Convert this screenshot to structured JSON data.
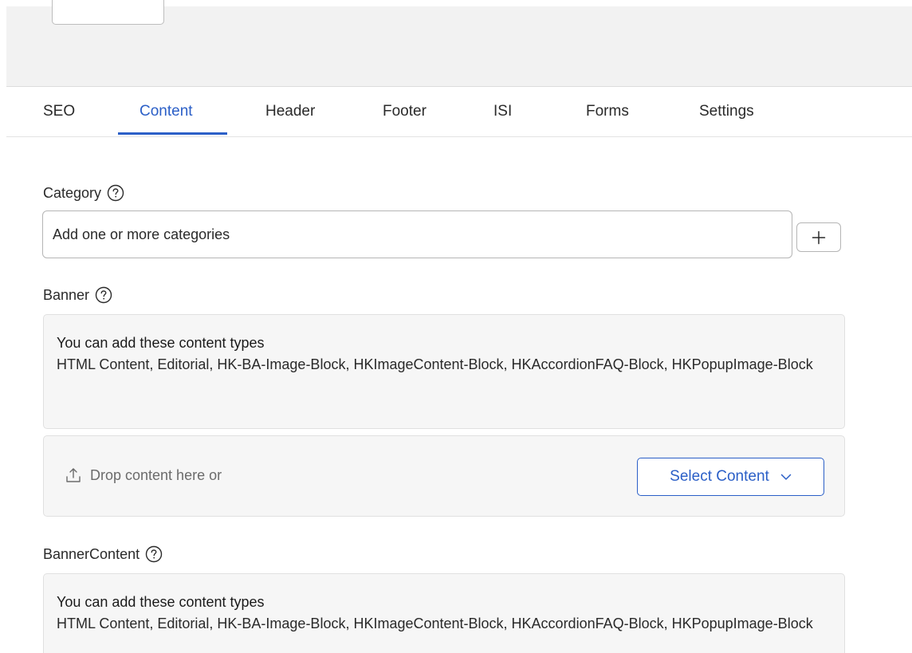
{
  "tabs": [
    {
      "label": "SEO",
      "active": false
    },
    {
      "label": "Content",
      "active": true
    },
    {
      "label": "Header",
      "active": false
    },
    {
      "label": "Footer",
      "active": false
    },
    {
      "label": "ISI",
      "active": false
    },
    {
      "label": "Forms",
      "active": false
    },
    {
      "label": "Settings",
      "active": false
    }
  ],
  "category": {
    "label": "Category",
    "placeholder": "Add one or more categories",
    "add_icon": "plus-icon"
  },
  "banner": {
    "label": "Banner",
    "types_title": "You can add these content types",
    "types_list": "HTML Content, Editorial, HK-BA-Image-Block, HKImageContent-Block, HKAccordionFAQ-Block, HKPopupImage-Block",
    "drop_text": "Drop content here or",
    "select_label": "Select Content"
  },
  "banner_content": {
    "label": "BannerContent",
    "types_title": "You can add these content types",
    "types_list": "HTML Content, Editorial, HK-BA-Image-Block, HKImageContent-Block, HKAccordionFAQ-Block, HKPopupImage-Block"
  },
  "colors": {
    "accent": "#2b5fc7",
    "panel_bg": "#f6f6f6",
    "header_bg": "#f2f2f2"
  }
}
